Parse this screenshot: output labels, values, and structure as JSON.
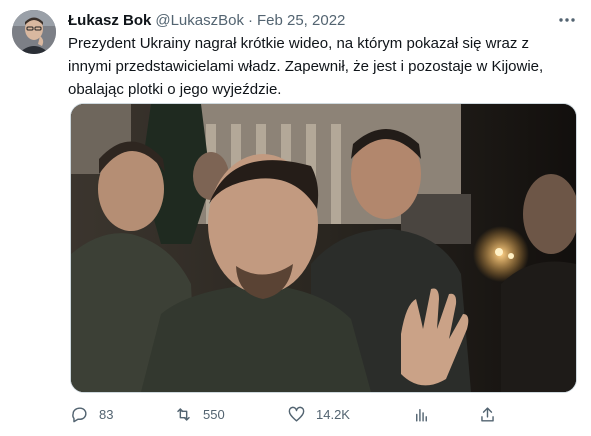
{
  "tweet": {
    "author_name": "Łukasz Bok",
    "handle": "@LukaszBok",
    "separator": "·",
    "date": "Feb 25, 2022",
    "text": "Prezydent Ukrainy nagrał krótkie wideo, na którym pokazał się wraz z innymi przedstawicielami władz. Zapewnił, że jest i pozostaje w Kijowie, obalając plotki o jego wyjeździe.",
    "more_icon": "more-horizontal-icon"
  },
  "actions": {
    "replies": "83",
    "retweets": "550",
    "likes": "14.2K"
  },
  "colors": {
    "text_primary": "#0f1419",
    "text_secondary": "#536471",
    "border": "#cfd9de"
  }
}
